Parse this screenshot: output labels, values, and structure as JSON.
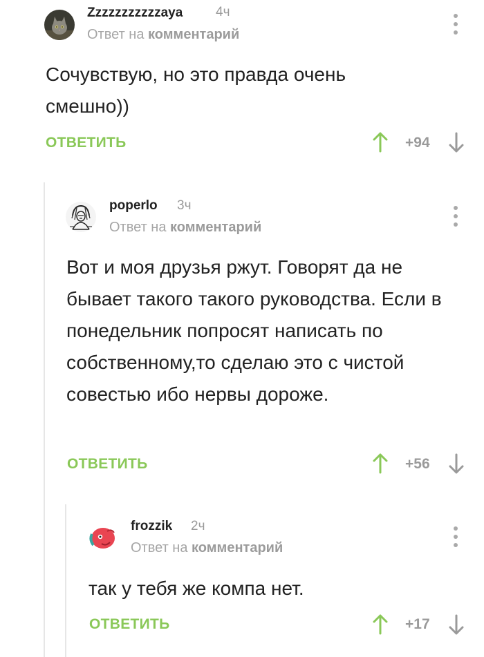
{
  "colors": {
    "accent_green": "#8ac858",
    "muted_gray": "#9a9a9a",
    "thread_line": "#e6e6e6"
  },
  "comments": [
    {
      "username": "Zzzzzzzzzzzaya",
      "time": "4ч",
      "reply_prefix": "Ответ на",
      "reply_target": "комментарий",
      "text": "Сочувствую, но это правда очень смешно))",
      "reply_label": "ОТВЕТИТЬ",
      "rating": "+94",
      "avatar_icon": "cat-avatar-icon"
    },
    {
      "username": "poperlo",
      "time": "3ч",
      "reply_prefix": "Ответ на",
      "reply_target": "комментарий",
      "text": "Вот и моя друзья ржут. Говорят да не бывает такого такого руководства. Если в понедельник попросят написать по собственному,то сделаю это с чистой совестью ибо нервы дороже.",
      "reply_label": "ОТВЕТИТЬ",
      "rating": "+56",
      "avatar_icon": "sketch-figure-avatar-icon"
    },
    {
      "username": "frozzik",
      "time": "2ч",
      "reply_prefix": "Ответ на",
      "reply_target": "комментарий",
      "text": "так у тебя же компа нет.",
      "reply_label": "ОТВЕТИТЬ",
      "rating": "+17",
      "avatar_icon": "red-creature-avatar-icon"
    }
  ]
}
